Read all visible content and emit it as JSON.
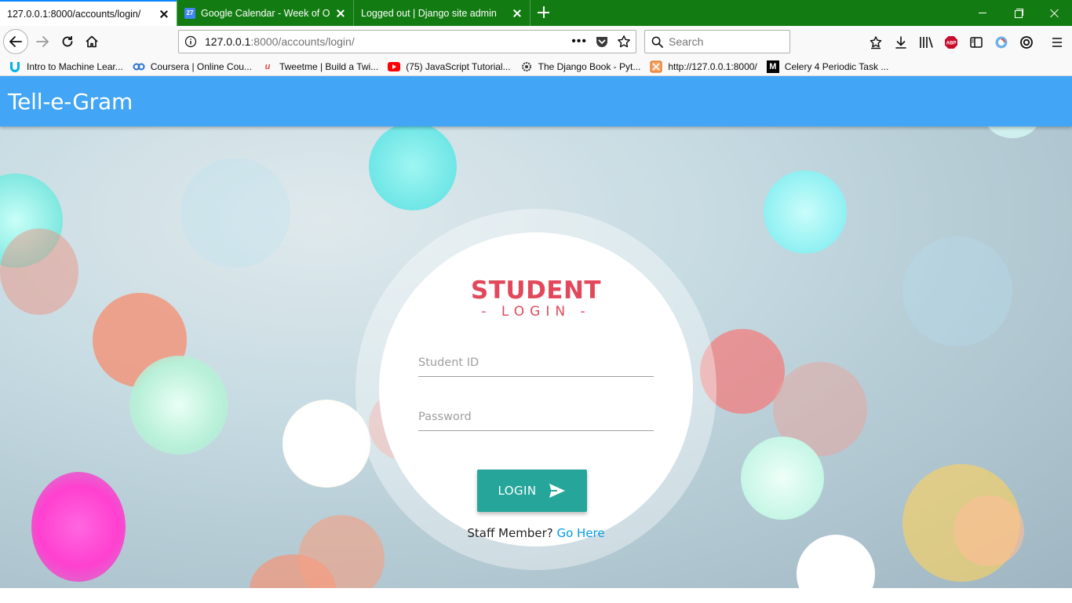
{
  "browser": {
    "tabs": [
      {
        "title": "127.0.0.1:8000/accounts/login/",
        "active": true
      },
      {
        "title": "Google Calendar - Week of October",
        "icon_text": "27",
        "active": false
      },
      {
        "title": "Logged out | Django site admin",
        "active": false
      }
    ],
    "url": {
      "host": "127.0.0.1",
      "path": ":8000/accounts/login/"
    },
    "search": {
      "placeholder": "Search"
    },
    "bookmarks": [
      {
        "label": "Intro to Machine Lear...",
        "icon": "udacity-icon",
        "color": "#02b3e4"
      },
      {
        "label": "Coursera | Online Cou...",
        "icon": "coursera-icon",
        "color": "#2a73cc"
      },
      {
        "label": "Tweetme | Build a Twi...",
        "icon": "tweetme-icon",
        "color": "#e04a3a"
      },
      {
        "label": "(75) JavaScript Tutorial...",
        "icon": "youtube-icon",
        "color": "#ff0000"
      },
      {
        "label": "The Django Book - Pyt...",
        "icon": "django-gear-icon",
        "color": "#333333"
      },
      {
        "label": "http://127.0.0.1:8000/",
        "icon": "broken-page-icon",
        "color": "#e05a00"
      },
      {
        "label": "Celery 4 Periodic Task ...",
        "icon": "medium-icon",
        "color": "#000000"
      }
    ]
  },
  "app": {
    "brand": "Tell-e-Gram",
    "header_color": "#42a5f5"
  },
  "login": {
    "title": "STUDENT",
    "subtitle": "- LOGIN -",
    "student_id_placeholder": "Student ID",
    "password_placeholder": "Password",
    "button_label": "LOGIN",
    "button_icon": "send-icon",
    "staff_prompt": "Staff Member?",
    "staff_link": "Go Here",
    "title_color": "#e2485a",
    "button_color": "#26a69a",
    "link_color": "#039be5"
  }
}
